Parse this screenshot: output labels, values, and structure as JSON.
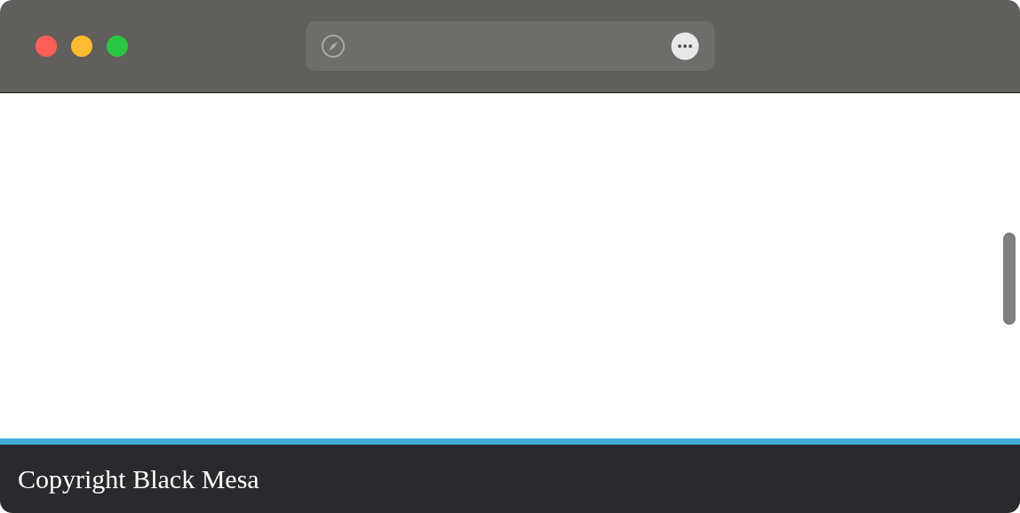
{
  "footer": {
    "text": "Copyright Black Mesa"
  }
}
